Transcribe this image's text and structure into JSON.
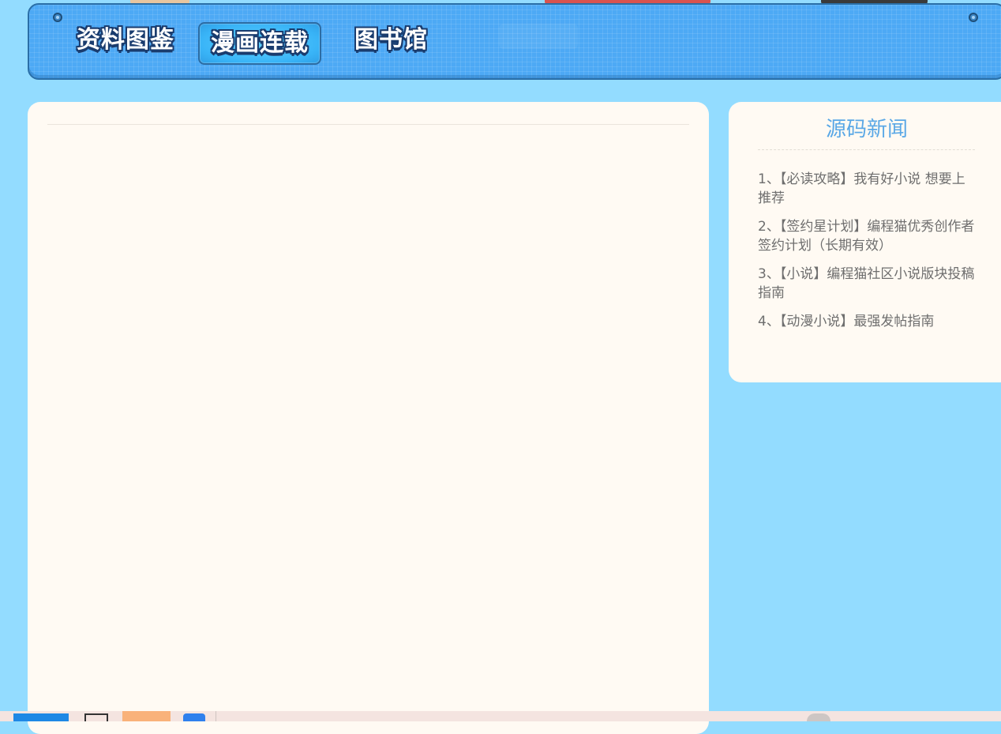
{
  "nav": {
    "items": [
      {
        "label": "资料图鉴"
      },
      {
        "label": "漫画连载",
        "active": true
      },
      {
        "label": "图书馆"
      }
    ]
  },
  "news": {
    "title": "源码新闻",
    "items": [
      {
        "text": "1、【必读攻略】我有好小说 想要上推荐"
      },
      {
        "text": "2、【签约星计划】编程猫优秀创作者签约计划（长期有效）"
      },
      {
        "text": "3、【小说】编程猫社区小说版块投稿指南"
      },
      {
        "text": "4、【动漫小说】最强发帖指南"
      }
    ]
  },
  "colors": {
    "page_background": "#93dcff",
    "nav_background": "#4da9f5",
    "panel_background": "#fffaf3",
    "news_title": "#5aa8e6",
    "news_text": "#6e6e6e"
  }
}
